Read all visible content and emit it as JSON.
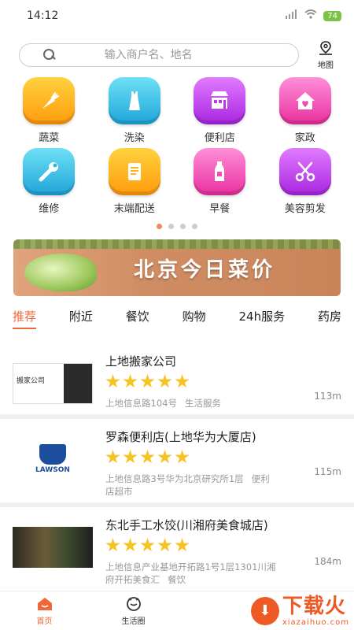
{
  "status_bar": {
    "time": "14:12",
    "battery": "74"
  },
  "search": {
    "placeholder": "输入商户名、地名",
    "map_label": "地图"
  },
  "categories": [
    {
      "label": "蔬菜",
      "icon": "carrot-icon",
      "color": "#ffb31f"
    },
    {
      "label": "洗染",
      "icon": "dress-icon",
      "color": "#2fb6e0"
    },
    {
      "label": "便利店",
      "icon": "shop-icon",
      "color": "#b93ae8"
    },
    {
      "label": "家政",
      "icon": "house-heart-icon",
      "color": "#ef4fb0"
    },
    {
      "label": "维修",
      "icon": "wrench-icon",
      "color": "#2fb6e0"
    },
    {
      "label": "末端配送",
      "icon": "clipboard-icon",
      "color": "#ffb31f"
    },
    {
      "label": "早餐",
      "icon": "milk-bottle-icon",
      "color": "#ef4fb0"
    },
    {
      "label": "美容剪发",
      "icon": "scissors-icon",
      "color": "#b93ae8"
    }
  ],
  "carousel": {
    "active_index": 0,
    "count": 4
  },
  "banner": {
    "title": "北京今日菜价"
  },
  "tabs": [
    "推荐",
    "附近",
    "餐饮",
    "购物",
    "24h服务",
    "药房"
  ],
  "listings": [
    {
      "name": "上地搬家公司",
      "rating": 5,
      "address": "上地信息路104号",
      "category": "生活服务",
      "distance": "113m",
      "thumb_text": "搬家公司"
    },
    {
      "name": "罗森便利店(上地华为大厦店)",
      "rating": 5,
      "address": "上地信息路3号华为北京研究所1层",
      "category": "便利店超市",
      "distance": "115m",
      "thumb_text": "LAWSON"
    },
    {
      "name": "东北手工水饺(川湘府美食城店)",
      "rating": 5,
      "address": "上地信息产业基地开拓路1号1层1301川湘府开拓美食汇",
      "category": "餐饮",
      "distance": "184m",
      "thumb_text": ""
    }
  ],
  "bottom_nav": {
    "home": "首页",
    "life": "生活圈"
  },
  "watermark": {
    "big": "下载火",
    "small": "xiazaihuo.com"
  }
}
